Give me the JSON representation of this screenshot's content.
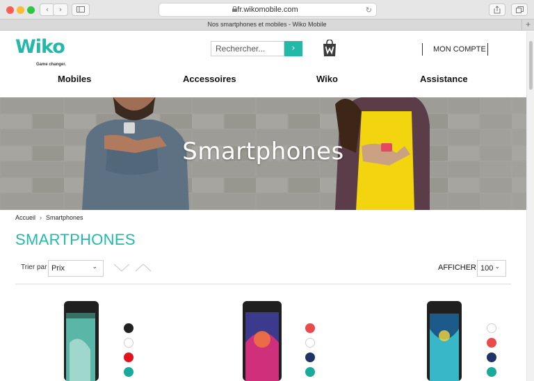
{
  "browser": {
    "url": "fr.wikomobile.com",
    "tab_title": "Nos smartphones et mobiles - Wiko Mobile",
    "new_tab": "+"
  },
  "header": {
    "logo_text": "Wiko",
    "tagline": "Game changer.",
    "search_placeholder": "Rechercher...",
    "search_button_icon": "chevron-right-icon",
    "cart_icon": "shopping-bag-icon",
    "account_label": "MON COMPTE"
  },
  "menu": [
    {
      "label": "Mobiles"
    },
    {
      "label": "Accessoires"
    },
    {
      "label": "Wiko"
    },
    {
      "label": "Assistance"
    }
  ],
  "hero": {
    "title": "Smartphones"
  },
  "breadcrumb": {
    "home": "Accueil",
    "current": "Smartphones"
  },
  "page_title": "SMARTPHONES",
  "sort": {
    "label": "Trier par",
    "selected": "Prix"
  },
  "display": {
    "label": "AFFICHER:",
    "selected": "100"
  },
  "colors": {
    "accent": "#22b9a9"
  },
  "products": [
    {
      "swatches": [
        "#222222",
        "#ffffff",
        "#e3131b",
        "#1aa99b"
      ]
    },
    {
      "swatches": [
        "#e94b4b",
        "#ffffff",
        "#1f3366",
        "#1aa99b"
      ]
    },
    {
      "swatches": [
        "#ffffff",
        "#e94b4b",
        "#1f3366",
        "#1aa99b"
      ]
    }
  ]
}
